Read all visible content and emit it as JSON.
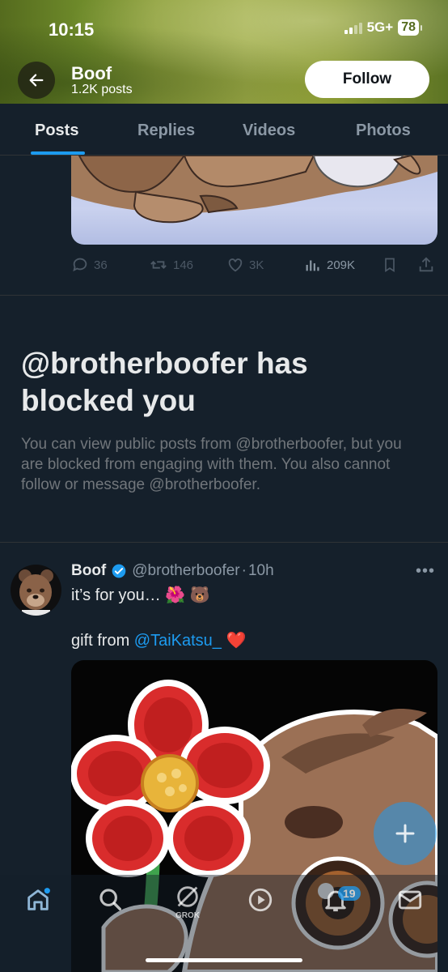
{
  "status": {
    "time": "10:15",
    "network": "5G+",
    "battery": "78"
  },
  "header": {
    "name": "Boof",
    "posts_count": "1.2K posts",
    "follow_label": "Follow"
  },
  "tabs": [
    {
      "label": "Posts"
    },
    {
      "label": "Replies"
    },
    {
      "label": "Videos"
    },
    {
      "label": "Photos"
    }
  ],
  "prev_post": {
    "replies": "36",
    "reposts": "146",
    "likes": "3K",
    "views": "209K"
  },
  "blocked": {
    "title": "@brotherboofer has blocked you",
    "text": "You can view public posts from @brotherboofer, but you are blocked from engaging with them. You also cannot follow or message @brotherboofer."
  },
  "tweet": {
    "name": "Boof",
    "handle": "@brotherboofer",
    "separator": "·",
    "time": "10h",
    "text1": "it’s for you… 🌺 🐻",
    "text2_prefix": "gift from ",
    "mention": "@TaiKatsu_",
    "text2_suffix": " ❤️"
  },
  "nav": {
    "notifications_badge": "19",
    "grok_label": "GROK"
  },
  "colors": {
    "accent": "#1d9bf0",
    "bg": "#15202b"
  }
}
